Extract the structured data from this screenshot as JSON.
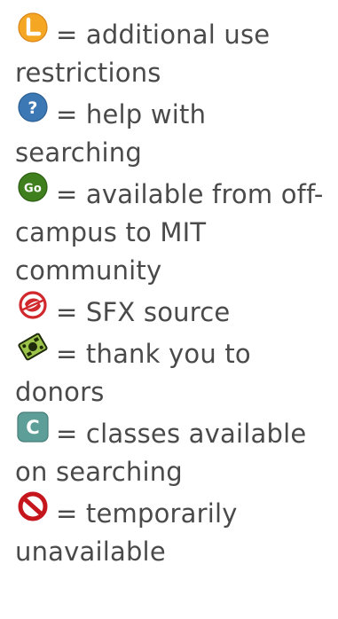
{
  "legend": {
    "items": [
      {
        "icon": "restricted-use-icon",
        "icon_letter": "L",
        "icon_color": "#f5a623",
        "equals": "=",
        "text": "additional use restrictions"
      },
      {
        "icon": "help-icon",
        "icon_letter": "?",
        "icon_color": "#3b78b4",
        "equals": "=",
        "text": "help with searching"
      },
      {
        "icon": "off-campus-icon",
        "icon_letter": "Go",
        "icon_color": "#3f7f1d",
        "equals": "=",
        "text": "available from off-campus to MIT community"
      },
      {
        "icon": "sfx-icon",
        "icon_color": "#d0282d",
        "equals": "=",
        "text": "SFX source"
      },
      {
        "icon": "donor-icon",
        "icon_color": "#6a8a2a",
        "equals": "=",
        "text": "thank you to donors"
      },
      {
        "icon": "classes-icon",
        "icon_letter": "C",
        "icon_color": "#5e9e98",
        "equals": "=",
        "text": "classes available on searching"
      },
      {
        "icon": "unavailable-icon",
        "icon_color": "#c4161c",
        "equals": "=",
        "text": "temporarily unavailable"
      }
    ]
  }
}
